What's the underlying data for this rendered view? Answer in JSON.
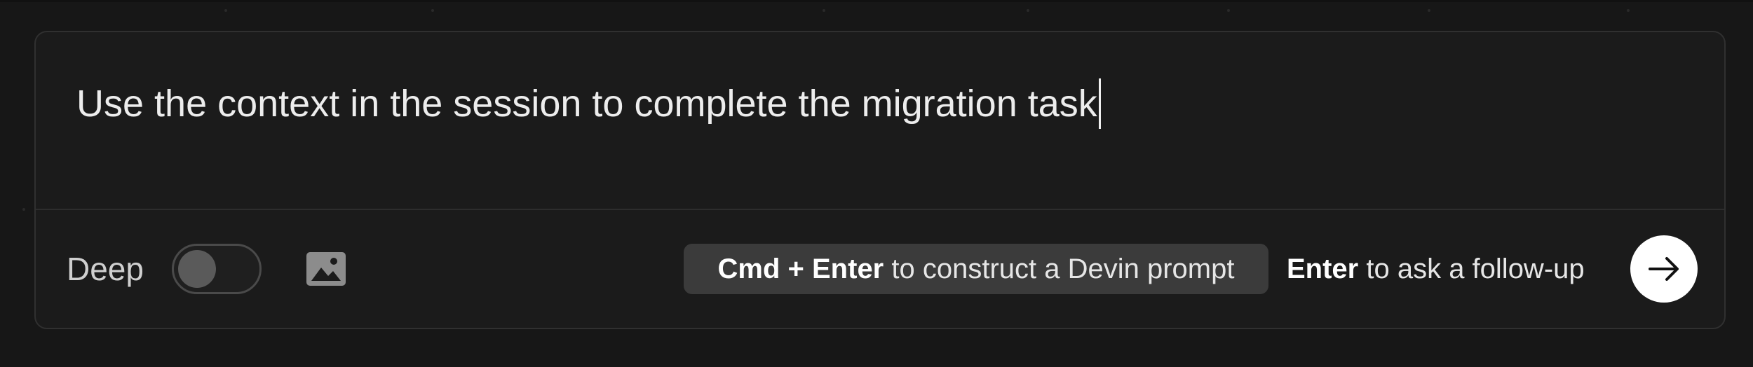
{
  "composer": {
    "prompt_text": "Use the context in the session to complete the migration task"
  },
  "footer": {
    "deep_label": "Deep",
    "deep_toggle_on": false,
    "image_icon": "image-icon",
    "construct_hint": {
      "shortcut": "Cmd + Enter",
      "text": " to construct a Devin prompt"
    },
    "followup_hint": {
      "shortcut": "Enter",
      "text": " to ask a follow-up"
    },
    "send_icon": "arrow-right-icon"
  },
  "colors": {
    "background": "#171717",
    "composer_bg": "#1b1b1b",
    "border": "#303030",
    "pill_bg": "#3b3b3b",
    "send_bg": "#ffffff"
  }
}
